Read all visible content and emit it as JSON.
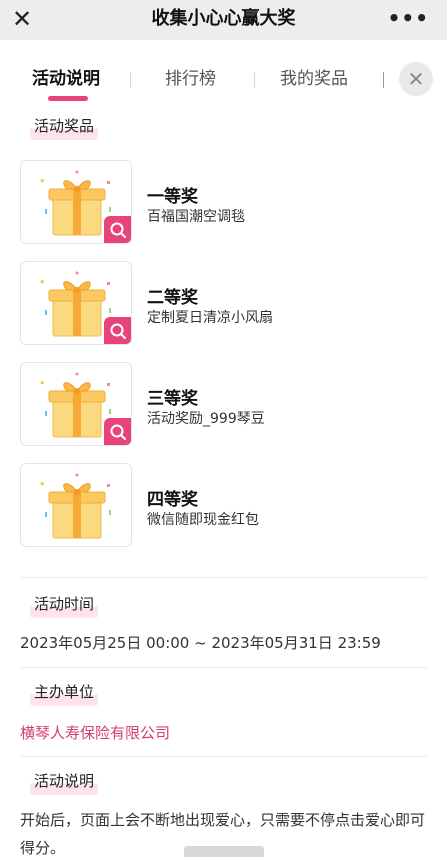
{
  "header": {
    "close_icon": "close-icon",
    "title": "收集小心心赢大奖",
    "more_icon": "more-dots-icon",
    "more_label": "•••"
  },
  "tabs": {
    "items": [
      {
        "label": "活动说明",
        "active": true
      },
      {
        "label": "排行榜",
        "active": false
      },
      {
        "label": "我的奖品",
        "active": false
      }
    ],
    "close_icon": "close-icon",
    "accent_color": "#e8447a"
  },
  "prizes_section": {
    "title": "活动奖品",
    "items": [
      {
        "rank": "一等奖",
        "name": "百福国潮空调毯",
        "has_zoom": true
      },
      {
        "rank": "二等奖",
        "name": "定制夏日清凉小风扇",
        "has_zoom": true
      },
      {
        "rank": "三等奖",
        "name": "活动奖励_999琴豆",
        "has_zoom": true
      },
      {
        "rank": "四等奖",
        "name": "微信随即现金红包",
        "has_zoom": false
      }
    ]
  },
  "time_section": {
    "title": "活动时间",
    "value": "2023年05月25日 00:00 ~ 2023年05月31日 23:59"
  },
  "organizer_section": {
    "title": "主办单位",
    "value": "横琴人寿保险有限公司"
  },
  "rules_section": {
    "title": "活动说明",
    "value": "开始后，页面上会不断地出现爱心，只需要不停点击爱心即可得分。"
  }
}
